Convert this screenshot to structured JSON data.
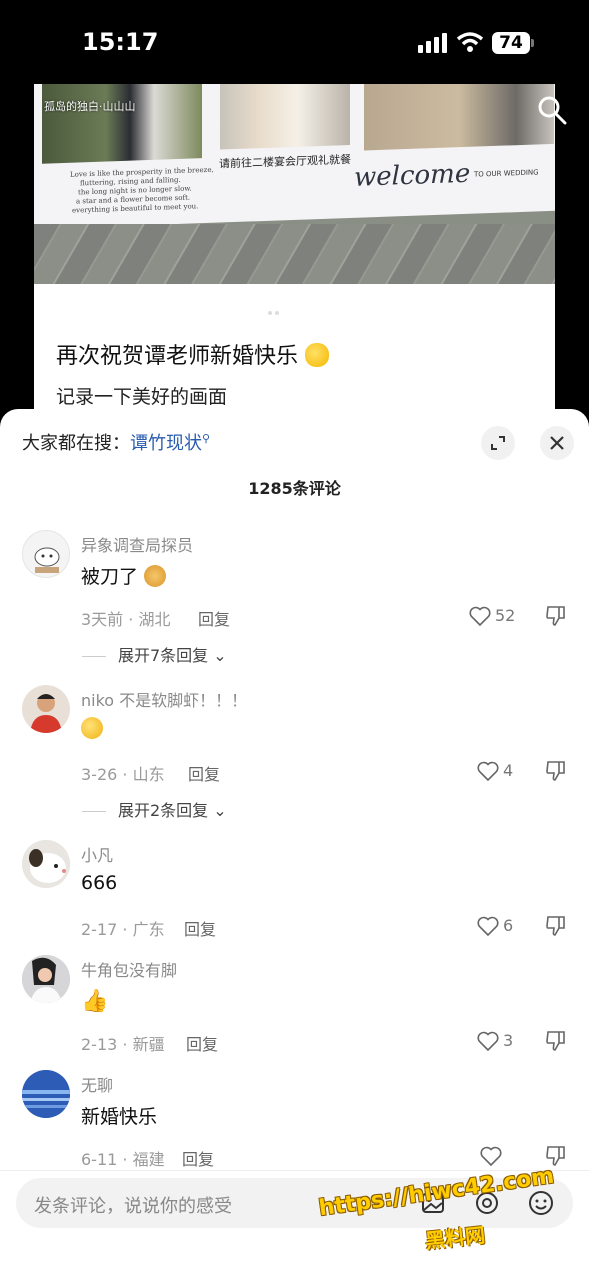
{
  "status_bar": {
    "time": "15:17",
    "battery": "74"
  },
  "post": {
    "overlay_user": "孤岛的独白·山山山",
    "banner": {
      "poem": [
        "Love is like the prosperity in the breeze,",
        "fluttering, rising and falling.",
        "the long night is no longer slow.",
        "a star and a flower become soft.",
        "everything is beautiful to meet you."
      ],
      "chinese": "请前往二楼宴会厅观礼就餐",
      "welcome": "welcome",
      "to_wedding": "TO OUR WEDDING"
    },
    "title": "再次祝贺谭老师新婚快乐",
    "subtitle": "记录一下美好的画面"
  },
  "sheet": {
    "search_prefix": "大家都在搜：",
    "search_keyword": "谭竹现状",
    "comment_count": "1285条评论"
  },
  "comments": [
    {
      "user": "异象调查局探员",
      "text": "被刀了",
      "meta": "3天前 · 湖北",
      "reply": "回复",
      "likes": "52",
      "expand": "展开7条回复"
    },
    {
      "user": "niko 不是软脚虾！！！",
      "text": "",
      "meta": "3-26 · 山东",
      "reply": "回复",
      "likes": "4",
      "expand": "展开2条回复"
    },
    {
      "user": "小凡",
      "text": "666",
      "meta": "2-17 · 广东",
      "reply": "回复",
      "likes": "6"
    },
    {
      "user": "牛角包没有脚",
      "text": "",
      "meta": "2-13 · 新疆",
      "reply": "回复",
      "likes": "3"
    },
    {
      "user": "无聊",
      "text": "新婚快乐",
      "meta": "6-11 · 福建",
      "reply": "回复",
      "likes": ""
    }
  ],
  "input": {
    "placeholder": "发条评论，说说你的感受"
  },
  "watermark": {
    "line1": "https://hiwc42.com",
    "line2": "黑料网"
  },
  "colors": {
    "keyword": "#2a5db0",
    "watermark": "#ffcc00"
  }
}
